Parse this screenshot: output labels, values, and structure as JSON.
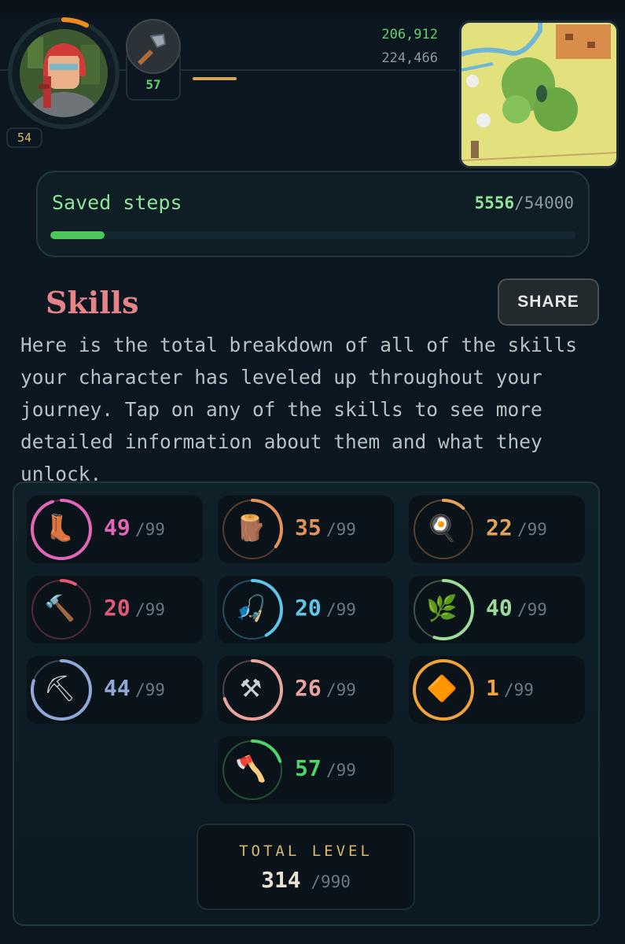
{
  "header": {
    "character_level": "54",
    "tool_level": "57",
    "xp_current": "206,912",
    "xp_next": "224,466",
    "icons": {
      "avatar": "character-portrait",
      "tool": "axe-icon",
      "map": "world-map-icon"
    }
  },
  "steps": {
    "label": "Saved steps",
    "current": "5556",
    "max": "/54000",
    "progress_fraction": 0.1029,
    "fill_color": "#4cc75a"
  },
  "skills": {
    "title": "Skills",
    "share_label": "SHARE",
    "description": "Here is the total breakdown of all of the skills your character has leveled up throughout your journey. Tap on any of the skills to see more detailed information about them and what they unlock.",
    "items": [
      {
        "icon": "boots-icon",
        "level": "49",
        "max": "/99",
        "color": "#e266b8",
        "progress": 0.95
      },
      {
        "icon": "log-icon",
        "level": "35",
        "max": "/99",
        "color": "#e3925a",
        "progress": 0.35
      },
      {
        "icon": "frying-pan-icon",
        "level": "22",
        "max": "/99",
        "color": "#e3a25a",
        "progress": 0.12
      },
      {
        "icon": "hammer-icon",
        "level": "20",
        "max": "/99",
        "color": "#e05a78",
        "progress": 0.08
      },
      {
        "icon": "fishing-rod-icon",
        "level": "20",
        "max": "/99",
        "color": "#5ec6e8",
        "progress": 0.42
      },
      {
        "icon": "herbs-icon",
        "level": "40",
        "max": "/99",
        "color": "#9edb9b",
        "progress": 0.55
      },
      {
        "icon": "pickaxe-icon",
        "level": "44",
        "max": "/99",
        "color": "#8fa8d6",
        "progress": 0.8
      },
      {
        "icon": "anvil-icon",
        "level": "26",
        "max": "/99",
        "color": "#e8a5a0",
        "progress": 0.7
      },
      {
        "icon": "gem-icon",
        "level": "1",
        "max": "/99",
        "color": "#f0a23c",
        "progress": 1.0
      },
      {
        "icon": "axe-icon",
        "level": "57",
        "max": "/99",
        "color": "#4fd46a",
        "progress": 0.2
      }
    ],
    "total_label": "TOTAL LEVEL",
    "total_current": "314",
    "total_max": "/990"
  }
}
